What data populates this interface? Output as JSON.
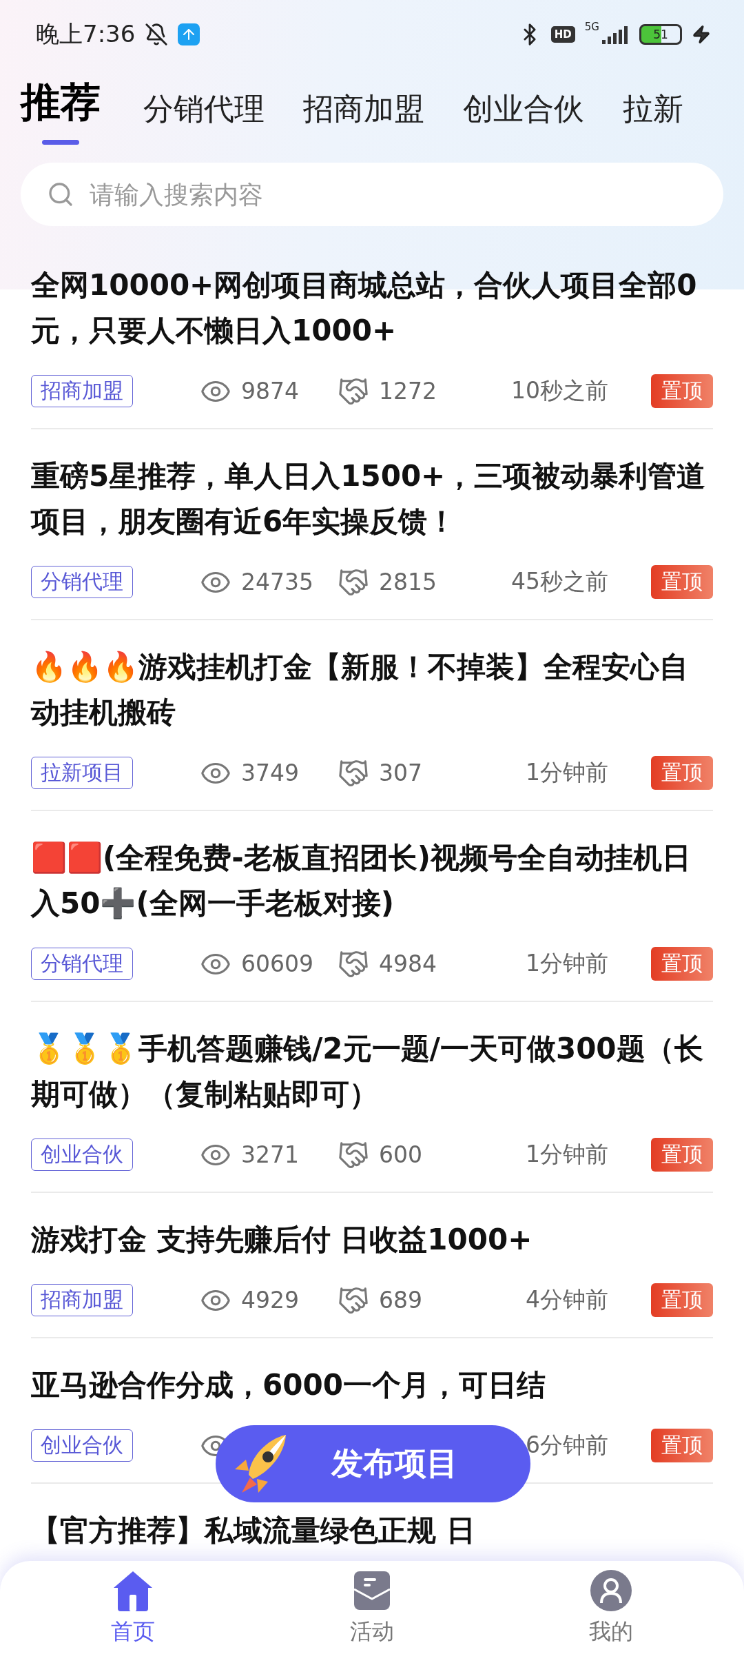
{
  "status_bar": {
    "time": "晚上7:36",
    "hd": "HD",
    "network": "5G",
    "battery": "51"
  },
  "tabs": [
    {
      "label": "推荐",
      "selected": true
    },
    {
      "label": "分销代理",
      "selected": false
    },
    {
      "label": "招商加盟",
      "selected": false
    },
    {
      "label": "创业合伙",
      "selected": false
    },
    {
      "label": "拉新",
      "selected": false
    }
  ],
  "search": {
    "placeholder": "请输入搜索内容"
  },
  "posts": [
    {
      "title": "全网10000+网创项目商城总站，合伙人项目全部0元，只要人不懒日入1000+",
      "tag": "招商加盟",
      "views": "9874",
      "likes": "1272",
      "time": "10秒之前",
      "badge": "置顶"
    },
    {
      "title": "重磅5星推荐，单人日入1500+，三项被动暴利管道项目，朋友圈有近6年实操反馈！",
      "tag": "分销代理",
      "views": "24735",
      "likes": "2815",
      "time": "45秒之前",
      "badge": "置顶"
    },
    {
      "title": "🔥🔥🔥游戏挂机打金【新服！不掉装】全程安心自动挂机搬砖",
      "tag": "拉新项目",
      "views": "3749",
      "likes": "307",
      "time": "1分钟前",
      "badge": "置顶"
    },
    {
      "title": "🟥🟥(全程免费-老板直招团长)视频号全自动挂机日入50➕(全网一手老板对接)",
      "tag": "分销代理",
      "views": "60609",
      "likes": "4984",
      "time": "1分钟前",
      "badge": "置顶"
    },
    {
      "title": "🥇🥇🥇手机答题赚钱/2元一题/一天可做300题（长期可做）（复制粘贴即可）",
      "tag": "创业合伙",
      "views": "3271",
      "likes": "600",
      "time": "1分钟前",
      "badge": "置顶"
    },
    {
      "title": "游戏打金 支持先赚后付 日收益1000+",
      "tag": "招商加盟",
      "views": "4929",
      "likes": "689",
      "time": "4分钟前",
      "badge": "置顶"
    },
    {
      "title": "亚马逊合作分成，6000一个月，可日结",
      "tag": "创业合伙",
      "time": "6分钟前",
      "badge": "置顶"
    },
    {
      "title": "【官方推荐】私域流量绿色正规 日"
    }
  ],
  "publish_button": {
    "label": "发布项目"
  },
  "bottom_nav": [
    {
      "label": "首页",
      "kind": "home",
      "selected": true
    },
    {
      "label": "活动",
      "kind": "message",
      "selected": false
    },
    {
      "label": "我的",
      "kind": "profile",
      "selected": false
    }
  ]
}
